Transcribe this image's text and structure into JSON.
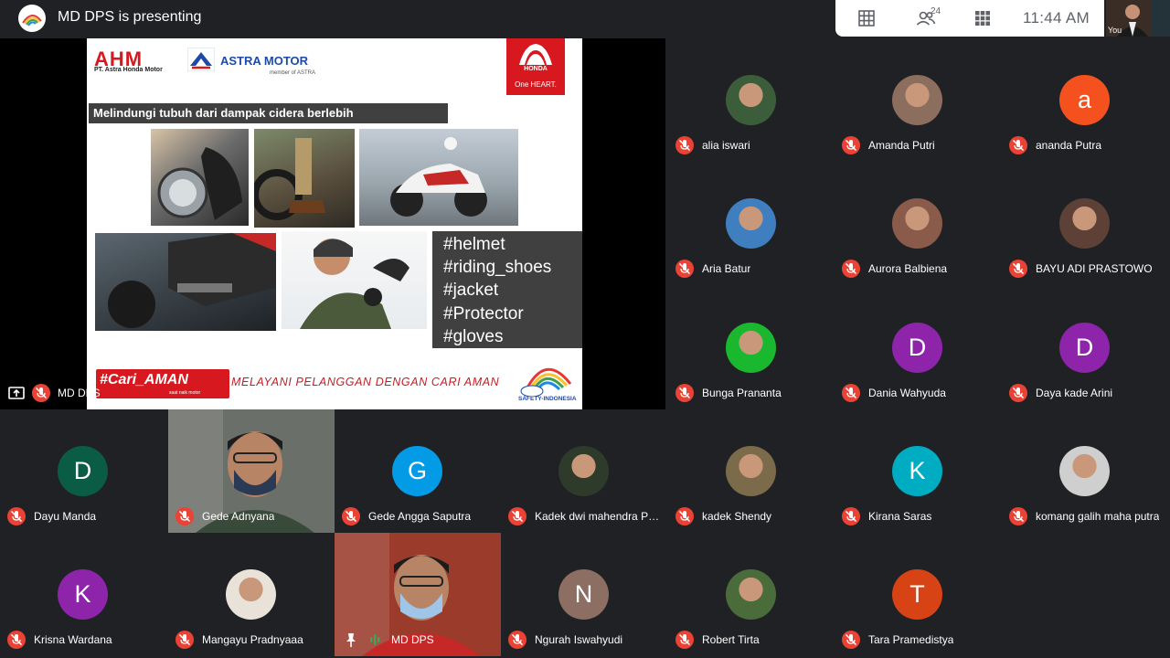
{
  "header": {
    "presenting_text": "MD DPS is presenting",
    "time": "11:44 AM",
    "participant_count": "24",
    "self_label": "You"
  },
  "slide": {
    "ahm_logo": "AHM",
    "ahm_sub": "PT. Astra Honda Motor",
    "astra_brand": "ASTRA MOTOR",
    "astra_sub": "member of ASTRA",
    "honda_brand": "HONDA",
    "honda_slogan": "One HEART.",
    "heading": "Melindungi tubuh dari dampak cidera berlebih",
    "hashtags": [
      "#helmet",
      "#riding_shoes",
      "#jacket",
      "#Protector",
      "#gloves"
    ],
    "campaign_logo": "#Cari_AMAN",
    "campaign_sub": "saat naik motor",
    "slogan": "MELAYANI PELANGGAN DENGAN CARI AMAN",
    "safety_logo_text": "SAFETY-INDONESIA"
  },
  "presenter": {
    "name": "MD DPS"
  },
  "participants": [
    {
      "name": "alia iswari",
      "type": "photo",
      "color": "#3b5d3a"
    },
    {
      "name": "Amanda Putri",
      "type": "photo",
      "color": "#8c6e5f"
    },
    {
      "name": "ananda Putra",
      "type": "letter",
      "letter": "a",
      "color": "#f4511e"
    },
    {
      "name": "Aria Batur",
      "type": "photo",
      "color": "#3f7fbf"
    },
    {
      "name": "Aurora Balbiena",
      "type": "photo",
      "color": "#8a5a4b"
    },
    {
      "name": "BAYU ADI PRASTOWO",
      "type": "photo",
      "color": "#5d4036"
    },
    {
      "name": "Bunga Prananta",
      "type": "photo",
      "color": "#19b82f"
    },
    {
      "name": "Dania Wahyuda",
      "type": "letter",
      "letter": "D",
      "color": "#8e24aa"
    },
    {
      "name": "Daya kade Arini",
      "type": "letter",
      "letter": "D",
      "color": "#8e24aa"
    },
    {
      "name": "Dayu Manda",
      "type": "letter",
      "letter": "D",
      "color": "#0b5c45"
    },
    {
      "name": "Gede Adnyana",
      "type": "video",
      "color": "#6b6f69"
    },
    {
      "name": "Gede Angga Saputra",
      "type": "letter",
      "letter": "G",
      "color": "#039be5"
    },
    {
      "name": "Kadek dwi mahendra Putr...",
      "type": "photo",
      "color": "#2e3a2a"
    },
    {
      "name": "kadek Shendy",
      "type": "photo",
      "color": "#7b6b4b"
    },
    {
      "name": "Kirana Saras",
      "type": "letter",
      "letter": "K",
      "color": "#00acc1"
    },
    {
      "name": "komang galih maha putra",
      "type": "photo",
      "color": "#cfcfcf"
    },
    {
      "name": "Krisna Wardana",
      "type": "letter",
      "letter": "K",
      "color": "#8e24aa"
    },
    {
      "name": "Mangayu Pradnyaaa",
      "type": "photo",
      "color": "#e8e2d8"
    },
    {
      "name": "MD DPS",
      "type": "video",
      "color": "#9a3b2b"
    },
    {
      "name": "Ngurah Iswahyudi",
      "type": "letter",
      "letter": "N",
      "color": "#8d6e63"
    },
    {
      "name": "Robert Tirta",
      "type": "photo",
      "color": "#4a6b3a"
    },
    {
      "name": "Tara Pramedistya",
      "type": "letter",
      "letter": "T",
      "color": "#d84315"
    }
  ]
}
